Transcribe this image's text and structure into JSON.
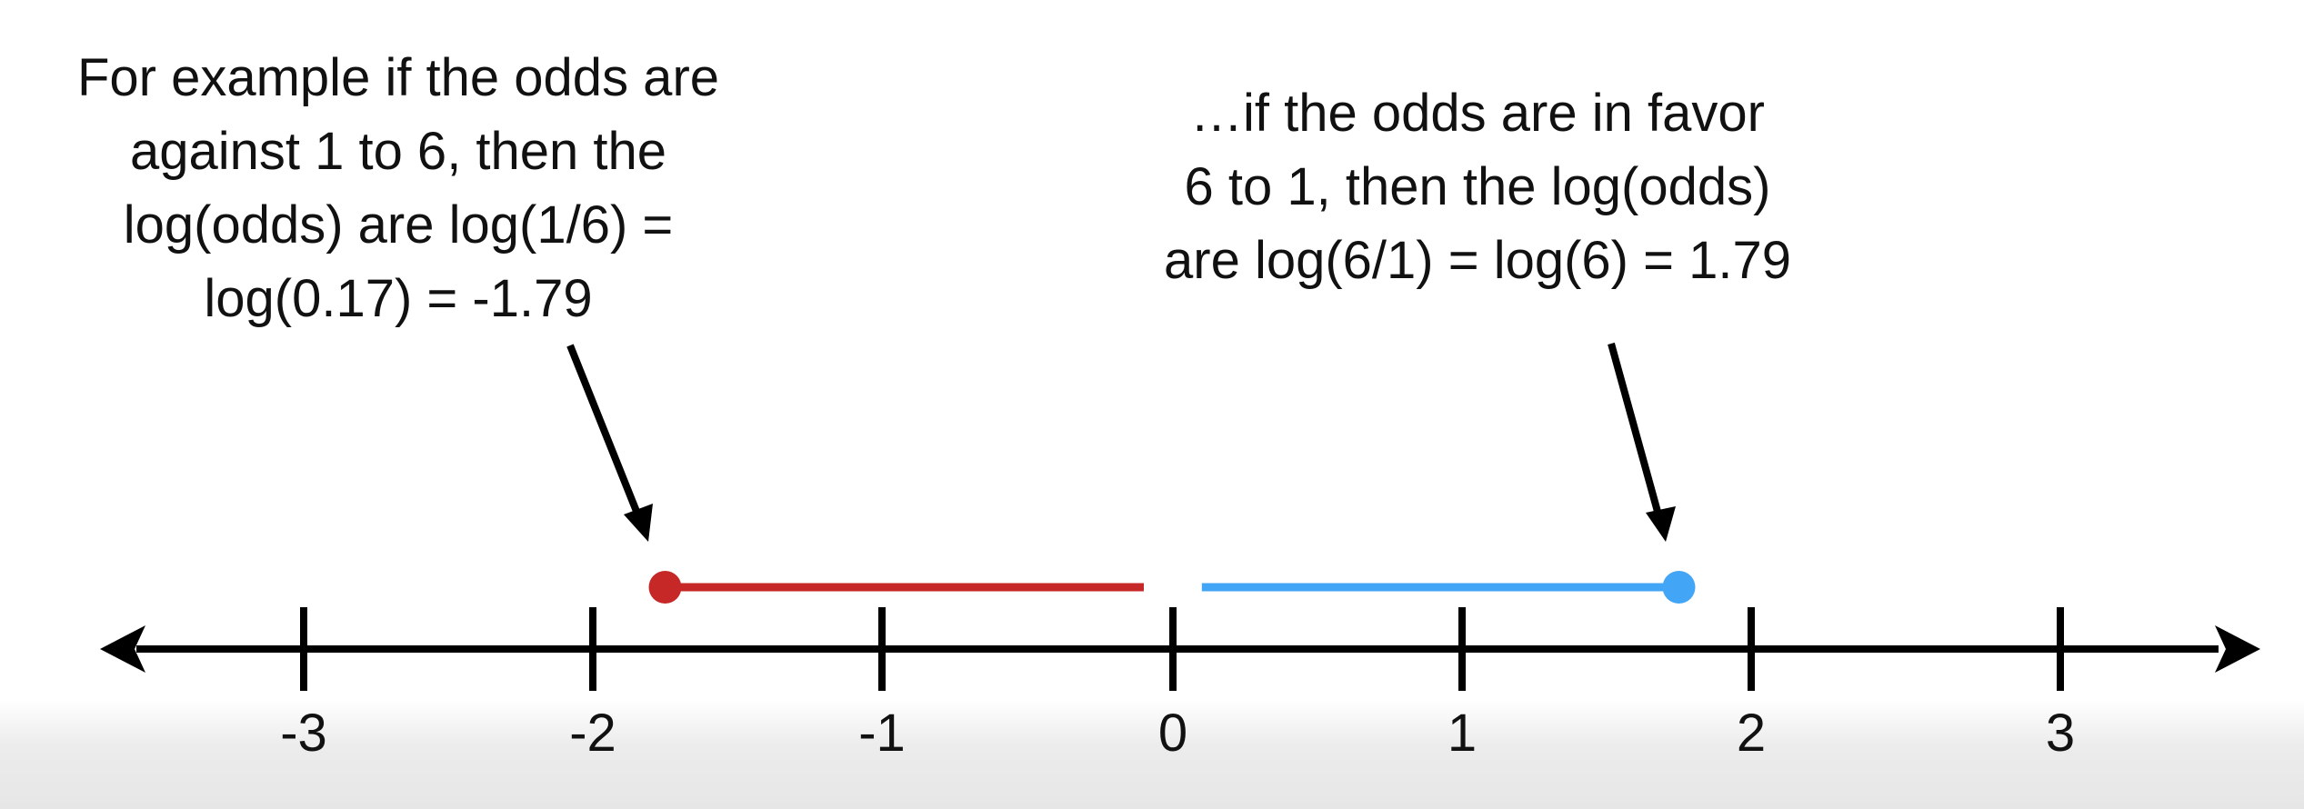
{
  "callouts": {
    "left": {
      "lines": [
        "For example if the odds are",
        "against 1 to 6, then the",
        "log(odds) are log(1/6) =",
        "log(0.17) = -1.79"
      ],
      "points_to": -1.75
    },
    "right": {
      "lines": [
        "…if the odds are in favor",
        "6 to 1, then the log(odds)",
        "are log(6/1) = log(6) = 1.79"
      ],
      "points_to": 1.75
    }
  },
  "number_line": {
    "ticks": [
      -3,
      -2,
      -1,
      0,
      1,
      2,
      3
    ],
    "tick_labels": [
      "-3",
      "-2",
      "-1",
      "0",
      "1",
      "2",
      "3"
    ],
    "segments": [
      {
        "name": "against-odds-segment",
        "from": -1.75,
        "to": -0.1,
        "color": "#c62828",
        "endpoint": -1.75
      },
      {
        "name": "favor-odds-segment",
        "from": 0.1,
        "to": 1.75,
        "color": "#42a5f5",
        "endpoint": 1.75
      }
    ],
    "axis_color": "#000000"
  }
}
